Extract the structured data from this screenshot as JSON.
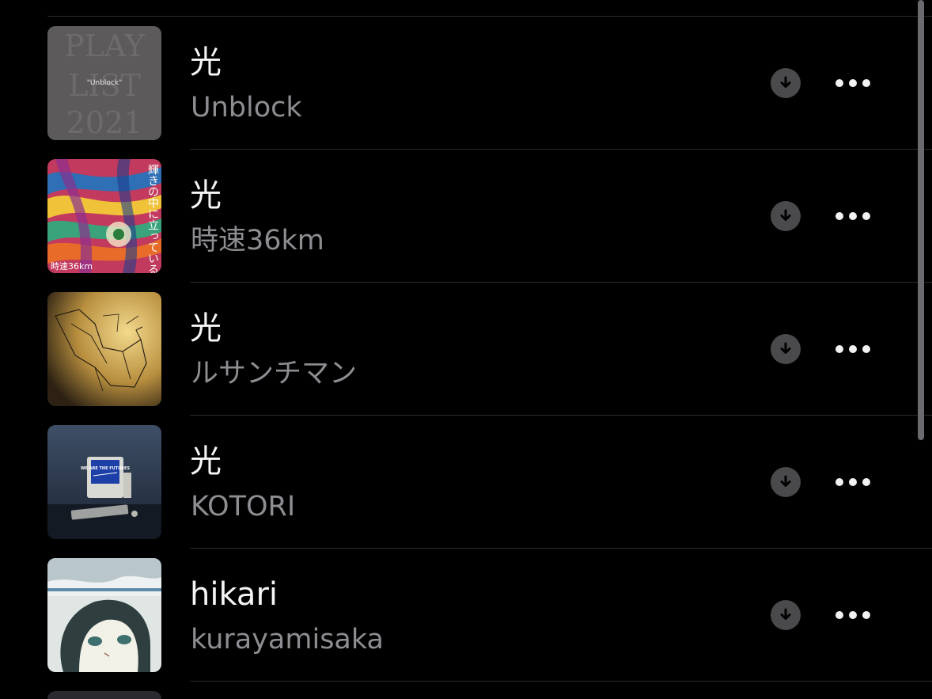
{
  "tracks": [
    {
      "title": "光",
      "artist": "Unblock",
      "artwork_text": [
        "PLAY",
        "LIST",
        "2021"
      ],
      "artwork_label": "\"Unblock\""
    },
    {
      "title": "光",
      "artist": "時速36km",
      "artwork_text": [
        "輝きの中に立っている"
      ],
      "artwork_label": "時速36km"
    },
    {
      "title": "光",
      "artist": "ルサンチマン"
    },
    {
      "title": "光",
      "artist": "KOTORI",
      "artwork_label": "WE ARE THE FUTURES"
    },
    {
      "title": "hikari",
      "artist": "kurayamisaka"
    }
  ],
  "icons": {
    "download": "download-circle-icon",
    "more": "ellipsis-icon"
  },
  "colors": {
    "background": "#000000",
    "title": "#f5f5f5",
    "artist": "#8d8d92",
    "divider": "#2a2a2c",
    "download_bg": "#4a4a4d"
  }
}
